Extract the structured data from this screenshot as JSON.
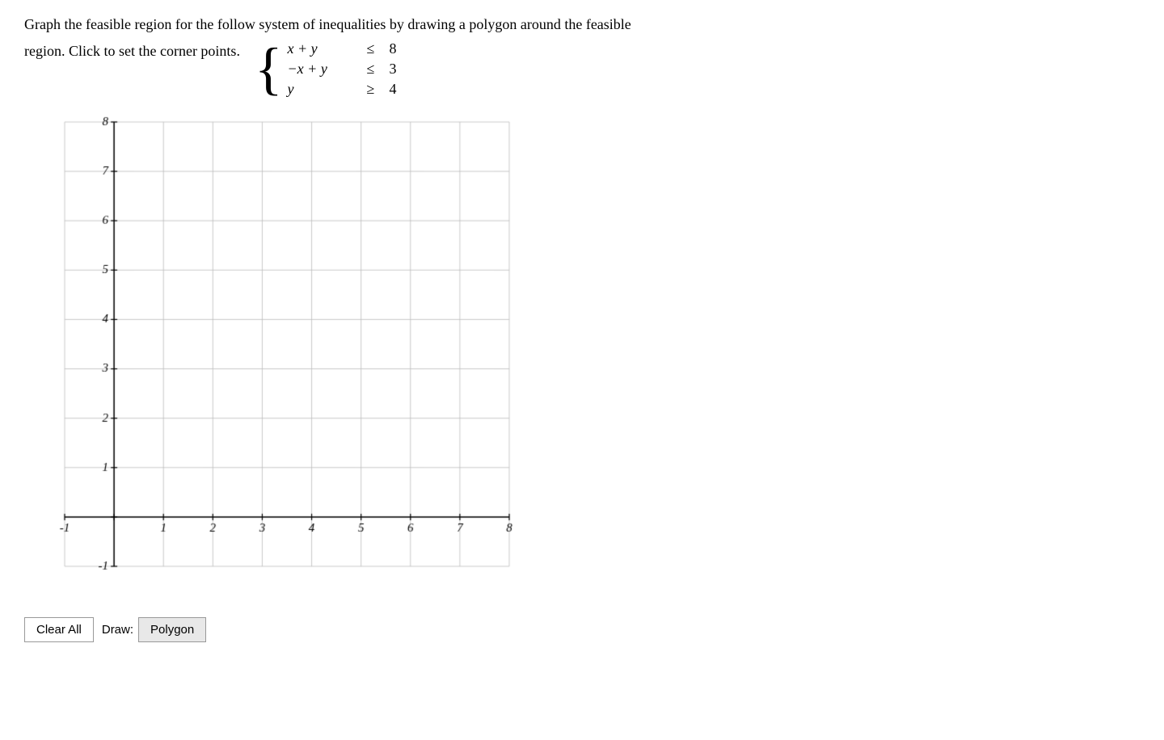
{
  "header": {
    "line1": "Graph the feasible region for the follow system of inequalities by drawing a polygon around the feasible",
    "line2": "region. Click to set the corner points.",
    "equations": [
      {
        "lhs": "x + y",
        "ineq": "≤",
        "rhs": "8"
      },
      {
        "lhs": "−x + y",
        "ineq": "≤",
        "rhs": "3"
      },
      {
        "lhs": "y",
        "ineq": "≥",
        "rhs": "4"
      }
    ]
  },
  "graph": {
    "xMin": -1,
    "xMax": 8,
    "yMin": -1,
    "yMax": 8,
    "xLabels": [
      "-1",
      "1",
      "2",
      "3",
      "4",
      "5",
      "6",
      "7",
      "8"
    ],
    "yLabels": [
      "-1",
      "1",
      "2",
      "3",
      "4",
      "5",
      "6",
      "7",
      "8"
    ]
  },
  "toolbar": {
    "clear_label": "Clear All",
    "draw_label": "Draw:",
    "polygon_label": "Polygon"
  }
}
